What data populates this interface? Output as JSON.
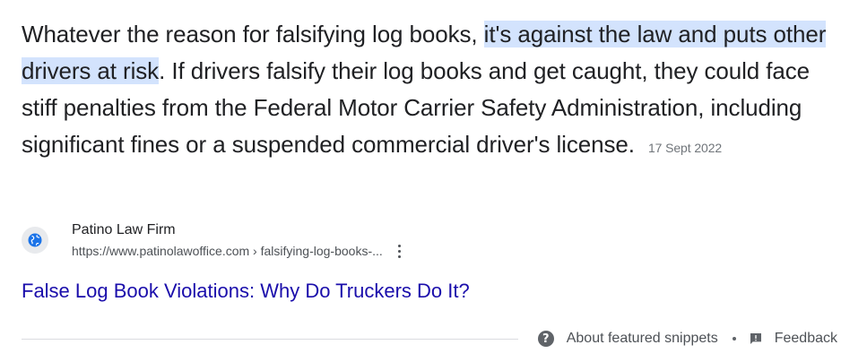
{
  "snippet": {
    "text_before": "Whatever the reason for falsifying log books, ",
    "highlight": "it's against the law and puts other drivers at risk",
    "text_after": ". If drivers falsify their log books and get caught, they could face stiff penalties from the Federal Motor Carrier Safety Administration, including significant fines or a suspended commercial driver's license.",
    "date": "17 Sept 2022"
  },
  "source": {
    "icon": "globe-icon",
    "name": "Patino Law Firm",
    "url": "https://www.patinolawoffice.com › falsifying-log-books-..."
  },
  "result": {
    "title": "False Log Book Violations: Why Do Truckers Do It?"
  },
  "footer": {
    "about_icon": "question-icon",
    "about_label": "About featured snippets",
    "separator": "•",
    "feedback_icon": "feedback-icon",
    "feedback_label": "Feedback"
  },
  "colors": {
    "highlight": "#d3e3fd",
    "link": "#1a0dab",
    "text": "#202124",
    "secondary": "#4d5156"
  }
}
